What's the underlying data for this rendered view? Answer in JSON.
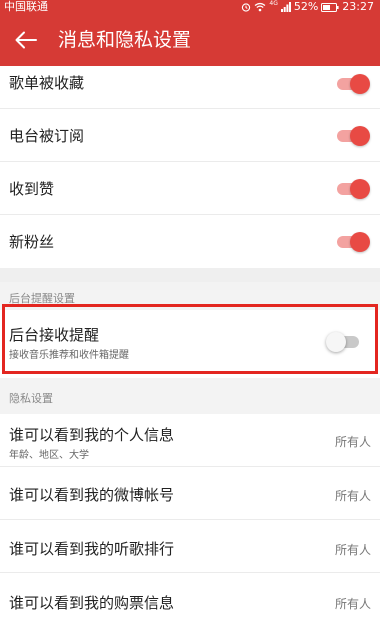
{
  "status_bar": {
    "carrier": "中国联通",
    "network": "4G",
    "battery": "52%",
    "time": "23:27"
  },
  "app_bar": {
    "title": "消息和隐私设置",
    "back_icon": "arrow-left-icon"
  },
  "notification_items": [
    {
      "label": "歌单被收藏",
      "enabled": true
    },
    {
      "label": "电台被订阅",
      "enabled": true
    },
    {
      "label": "收到赞",
      "enabled": true
    },
    {
      "label": "新粉丝",
      "enabled": true
    }
  ],
  "background_section": {
    "header": "后台提醒设置",
    "item": {
      "label": "后台接收提醒",
      "sub": "接收音乐推荐和收件箱提醒",
      "enabled": false
    }
  },
  "privacy_section": {
    "header": "隐私设置",
    "items": [
      {
        "label": "谁可以看到我的个人信息",
        "sub": "年龄、地区、大学",
        "value": "所有人"
      },
      {
        "label": "谁可以看到我的微博帐号",
        "value": "所有人"
      },
      {
        "label": "谁可以看到我的听歌排行",
        "value": "所有人"
      },
      {
        "label": "谁可以看到我的购票信息",
        "value": "所有人"
      }
    ]
  },
  "colors": {
    "accent": "#d63a35",
    "highlight_border": "#e32620",
    "toggle_on": "#e84a44",
    "toggle_on_track": "#f3a2a0"
  }
}
